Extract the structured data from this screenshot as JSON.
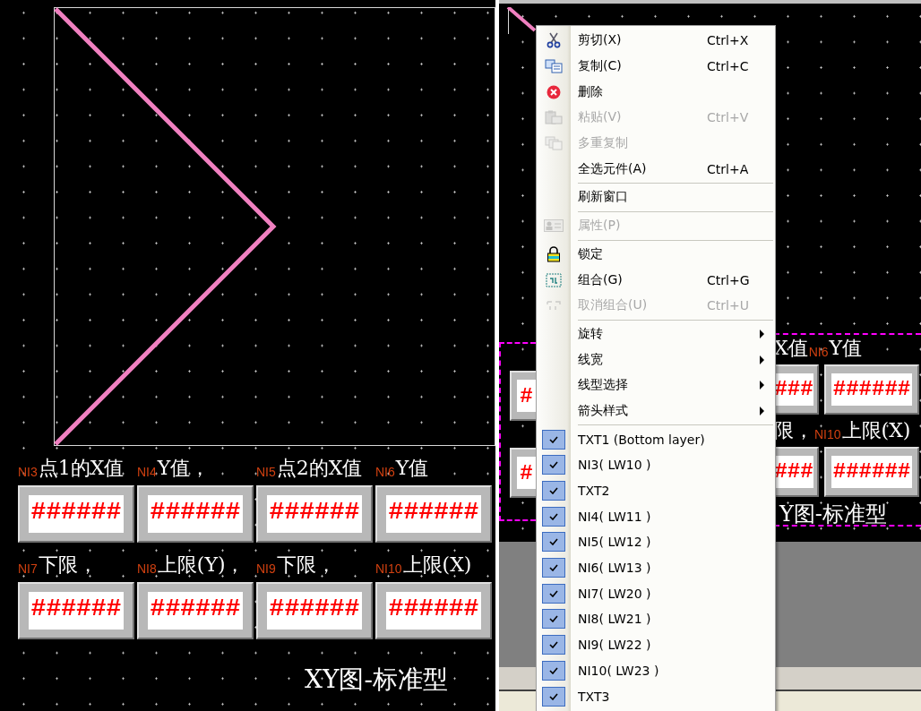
{
  "left_canvas": {
    "rows": [
      {
        "kind": "labels",
        "cells": [
          {
            "tag": "NI3",
            "label": "点1的X值"
          },
          {
            "tag": "NI4",
            "label": "Y值，"
          },
          {
            "tag": "NI5",
            "label": "点2的X值"
          },
          {
            "tag": "NI6",
            "label": "Y值"
          }
        ]
      },
      {
        "kind": "values",
        "cells": [
          "######",
          "######",
          "######",
          "######"
        ]
      },
      {
        "kind": "labels",
        "cells": [
          {
            "tag": "NI7",
            "label": "下限，"
          },
          {
            "tag": "NI8",
            "label": "上限(Y)，"
          },
          {
            "tag": "NI9",
            "label": "下限，"
          },
          {
            "tag": "NI10",
            "label": "上限(X)"
          }
        ]
      },
      {
        "kind": "values",
        "cells": [
          "######",
          "######",
          "######",
          "######"
        ]
      }
    ],
    "caption": "XY图-标准型"
  },
  "right_canvas": {
    "left_strip": {
      "values": [
        "#",
        "#"
      ]
    },
    "right_strip": {
      "rows": [
        {
          "kind": "labels",
          "cells": [
            {
              "label": "X值"
            },
            {
              "tag": "NI6",
              "label": "Y值"
            }
          ]
        },
        {
          "kind": "values",
          "cells": [
            "###",
            "######"
          ]
        },
        {
          "kind": "labels",
          "cells": [
            {
              "label": "限，"
            },
            {
              "tag": "NI10",
              "label": "上限(X)"
            }
          ]
        },
        {
          "kind": "values",
          "cells": [
            "###",
            "######"
          ]
        }
      ],
      "caption": "Y图-标准型"
    }
  },
  "context_menu": {
    "items": [
      {
        "kind": "command",
        "label": "剪切(X)",
        "shortcut": "Ctrl+X",
        "disabled": false
      },
      {
        "kind": "command",
        "label": "复制(C)",
        "shortcut": "Ctrl+C",
        "disabled": false
      },
      {
        "kind": "command",
        "label": "删除",
        "disabled": false
      },
      {
        "kind": "command",
        "label": "粘贴(V)",
        "shortcut": "Ctrl+V",
        "disabled": true
      },
      {
        "kind": "command",
        "label": "多重复制",
        "disabled": true
      },
      {
        "kind": "command",
        "label": "全选元件(A)",
        "shortcut": "Ctrl+A",
        "disabled": false
      },
      {
        "kind": "separator"
      },
      {
        "kind": "command",
        "label": "刷新窗口",
        "disabled": false
      },
      {
        "kind": "separator"
      },
      {
        "kind": "command",
        "label": "属性(P)",
        "disabled": true
      },
      {
        "kind": "separator"
      },
      {
        "kind": "command",
        "label": "锁定",
        "disabled": false
      },
      {
        "kind": "command",
        "label": "组合(G)",
        "shortcut": "Ctrl+G",
        "disabled": false
      },
      {
        "kind": "command",
        "label": "取消组合(U)",
        "shortcut": "Ctrl+U",
        "disabled": true
      },
      {
        "kind": "separator"
      },
      {
        "kind": "submenu",
        "label": "旋转"
      },
      {
        "kind": "submenu",
        "label": "线宽"
      },
      {
        "kind": "submenu",
        "label": "线型选择"
      },
      {
        "kind": "submenu",
        "label": "箭头样式"
      },
      {
        "kind": "separator"
      },
      {
        "kind": "check",
        "label": "TXT1 (Bottom layer)",
        "checked": true
      },
      {
        "kind": "check",
        "label": "NI3( LW10 )",
        "checked": true
      },
      {
        "kind": "check",
        "label": "TXT2",
        "checked": true
      },
      {
        "kind": "check",
        "label": "NI4( LW11 )",
        "checked": true
      },
      {
        "kind": "check",
        "label": "NI5( LW12 )",
        "checked": true
      },
      {
        "kind": "check",
        "label": "NI6( LW13 )",
        "checked": true
      },
      {
        "kind": "check",
        "label": "NI7( LW20 )",
        "checked": true
      },
      {
        "kind": "check",
        "label": "NI8( LW21 )",
        "checked": true
      },
      {
        "kind": "check",
        "label": "NI9( LW22 )",
        "checked": true
      },
      {
        "kind": "check",
        "label": "NI10( LW23 )",
        "checked": true
      },
      {
        "kind": "check",
        "label": "TXT3",
        "checked": true
      }
    ]
  }
}
